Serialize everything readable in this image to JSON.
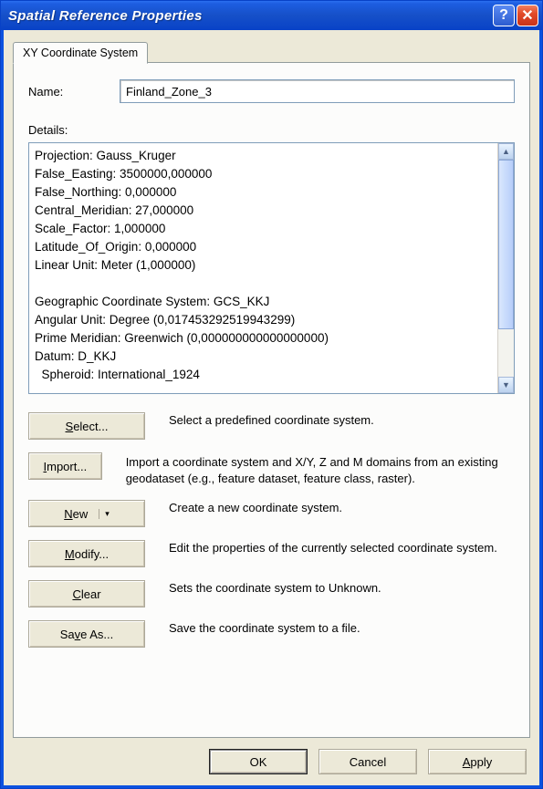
{
  "window": {
    "title": "Spatial Reference Properties"
  },
  "tab": {
    "label": "XY Coordinate System"
  },
  "fields": {
    "name_label": "Name:",
    "name_value": "Finland_Zone_3",
    "details_label": "Details:",
    "details_text": "Projection: Gauss_Kruger\nFalse_Easting: 3500000,000000\nFalse_Northing: 0,000000\nCentral_Meridian: 27,000000\nScale_Factor: 1,000000\nLatitude_Of_Origin: 0,000000\nLinear Unit: Meter (1,000000)\n\nGeographic Coordinate System: GCS_KKJ\nAngular Unit: Degree (0,017453292519943299)\nPrime Meridian: Greenwich (0,000000000000000000)\nDatum: D_KKJ\n  Spheroid: International_1924"
  },
  "actions": {
    "select": {
      "label": "Select...",
      "desc": "Select a predefined coordinate system."
    },
    "import": {
      "label": "Import...",
      "desc": "Import a coordinate system and X/Y, Z and M domains from an existing geodataset (e.g., feature dataset, feature class, raster)."
    },
    "new": {
      "label": "New",
      "desc": "Create a new coordinate system."
    },
    "modify": {
      "label": "Modify...",
      "desc": "Edit the properties of the currently selected coordinate system."
    },
    "clear": {
      "label": "Clear",
      "desc": "Sets the coordinate system to Unknown."
    },
    "saveas": {
      "label": "Save As...",
      "desc": "Save the coordinate system to a file."
    }
  },
  "footer": {
    "ok": "OK",
    "cancel": "Cancel",
    "apply": "Apply"
  }
}
